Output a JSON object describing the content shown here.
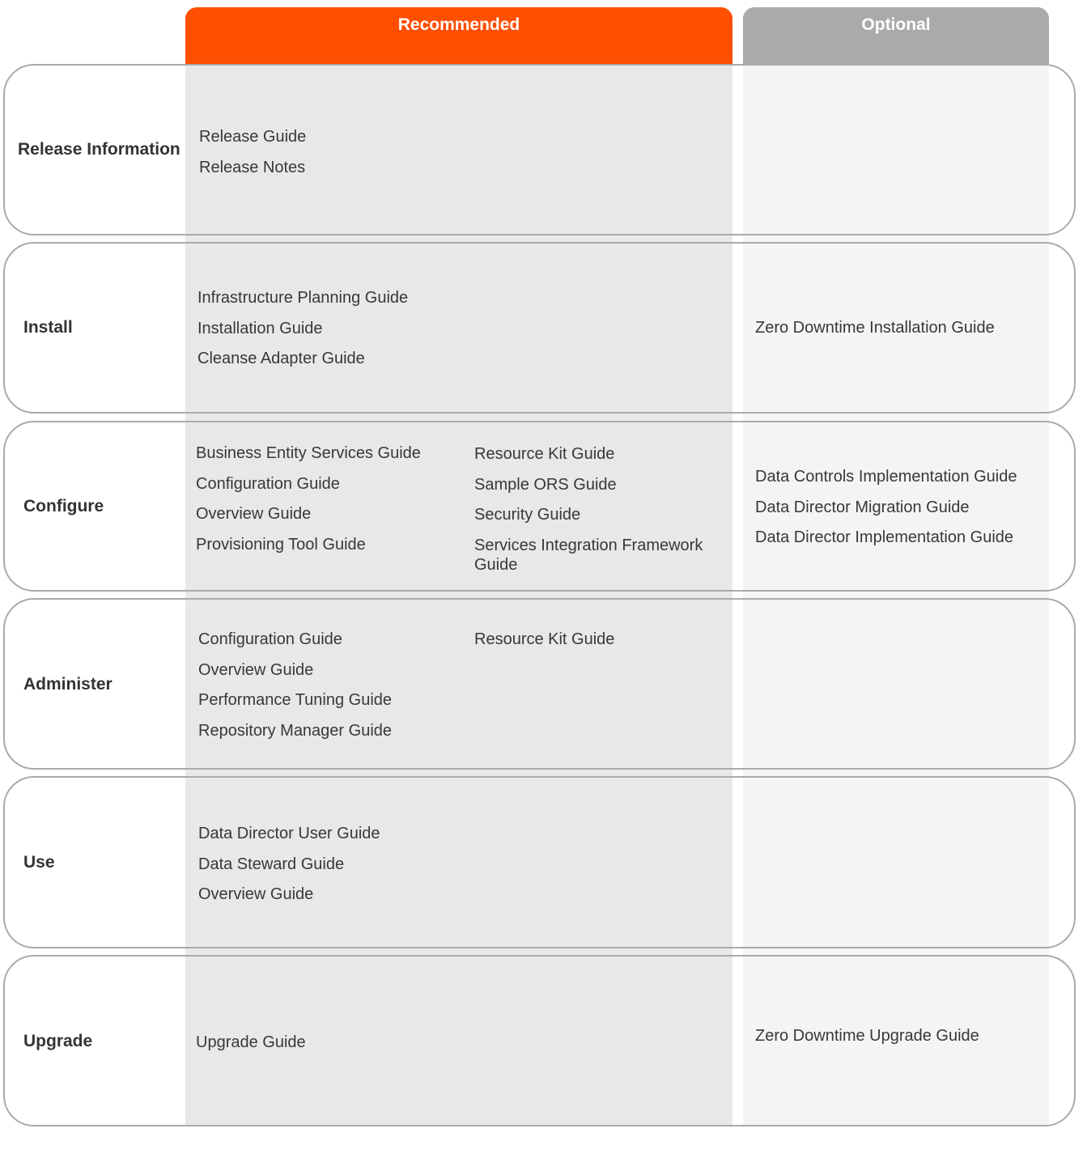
{
  "columns": {
    "recommended": {
      "label": "Recommended",
      "color": "#ff4f00"
    },
    "optional": {
      "label": "Optional",
      "color": "#aaaaaa"
    }
  },
  "rows": [
    {
      "label": "Release Information",
      "recommended_col1": [
        "Release Guide",
        "Release Notes"
      ],
      "recommended_col2": [],
      "optional": []
    },
    {
      "label": "Install",
      "recommended_col1": [
        "Infrastructure Planning Guide",
        "Installation Guide",
        "Cleanse Adapter Guide"
      ],
      "recommended_col2": [],
      "optional": [
        "Zero Downtime Installation Guide"
      ]
    },
    {
      "label": "Configure",
      "recommended_col1": [
        "Business Entity Services Guide",
        "Configuration Guide",
        "Overview Guide",
        "Provisioning Tool Guide"
      ],
      "recommended_col2": [
        "Resource Kit Guide",
        "Sample ORS Guide",
        "Security Guide",
        "Services Integration Framework Guide"
      ],
      "optional": [
        "Data Controls Implementation Guide",
        "Data Director Migration Guide",
        "Data Director Implementation Guide"
      ]
    },
    {
      "label": "Administer",
      "recommended_col1": [
        "Configuration Guide",
        "Overview Guide",
        "Performance Tuning Guide",
        "Repository Manager Guide"
      ],
      "recommended_col2": [
        "Resource Kit Guide"
      ],
      "optional": []
    },
    {
      "label": "Use",
      "recommended_col1": [
        "Data Director User Guide",
        "Data Steward Guide",
        "Overview Guide"
      ],
      "recommended_col2": [],
      "optional": []
    },
    {
      "label": "Upgrade",
      "recommended_col1": [
        "Upgrade Guide"
      ],
      "recommended_col2": [],
      "optional": [
        "Zero Downtime Upgrade Guide"
      ]
    }
  ]
}
